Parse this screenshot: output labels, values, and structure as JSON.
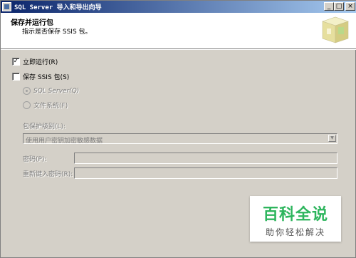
{
  "window": {
    "title": "SQL Server 导入和导出向导",
    "min_label": "_",
    "max_label": "□",
    "close_label": "×"
  },
  "header": {
    "title": "保存并运行包",
    "subtitle": "指示是否保存 SSIS 包。"
  },
  "options": {
    "run_immediately": {
      "label": "立即运行(R)",
      "checked": true,
      "mark": "✓"
    },
    "save_ssis": {
      "label": "保存 SSIS 包(S)",
      "checked": false
    },
    "sql_server": {
      "label": "SQL Server(Q)",
      "selected": true
    },
    "file_system": {
      "label": "文件系统(F)",
      "selected": false
    }
  },
  "protection": {
    "label": "包保护级别(L):",
    "value": "使用用户密钥加密敏感数据",
    "arrow": "▼"
  },
  "password": {
    "label": "密码(P):",
    "value": ""
  },
  "retype_password": {
    "label": "重新键入密码(R):",
    "value": ""
  },
  "watermark": {
    "brand": "百科全说",
    "tagline": "助你轻松解决",
    "color": "#2db55d"
  },
  "colors": {
    "titlebar_start": "#0a246a",
    "titlebar_end": "#a6caf0",
    "dialog_bg": "#d4d0c8"
  }
}
